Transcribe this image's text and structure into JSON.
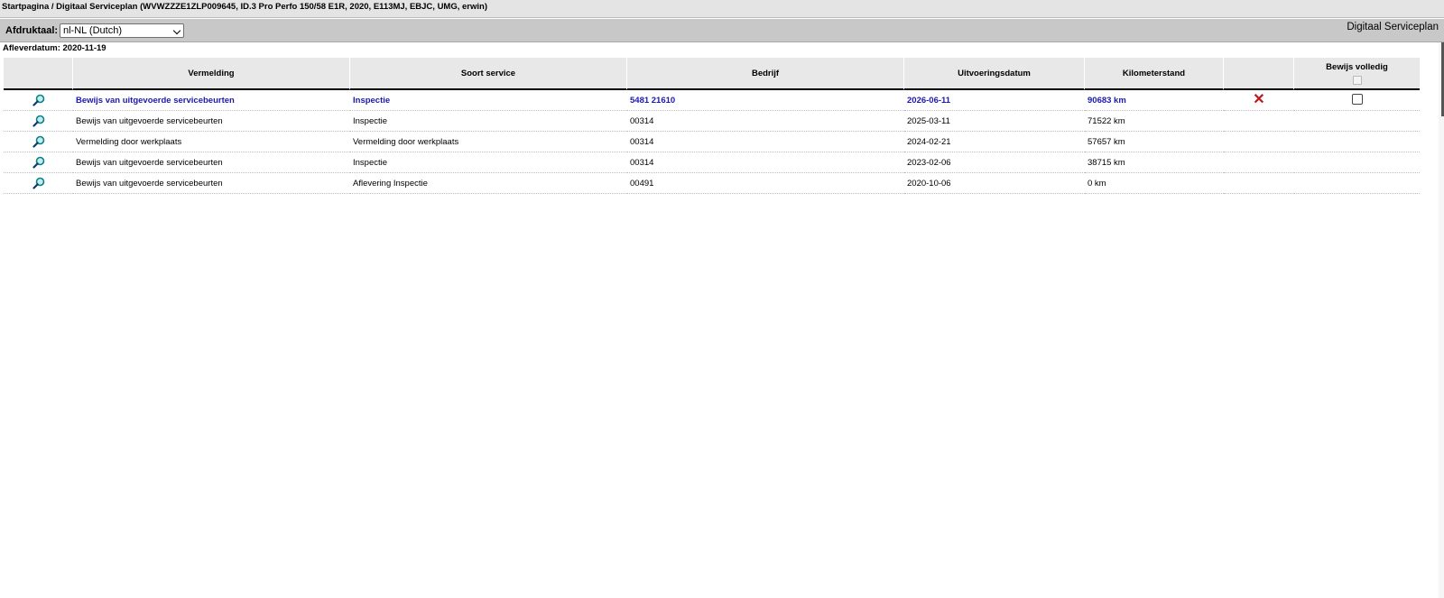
{
  "breadcrumb": "Startpagina / Digitaal Serviceplan (WVWZZZE1ZLP009645, ID.3 Pro Perfo 150/58 E1R, 2020, E113MJ, EBJC, UMG, erwin)",
  "toolbar": {
    "print_language_label": "Afdruktaal:",
    "print_language_value": "nl-NL (Dutch)",
    "module_title": "Digitaal Serviceplan"
  },
  "delivery_date": "Afleverdatum: 2020-11-19",
  "table": {
    "headers": {
      "vermelding": "Vermelding",
      "soort_service": "Soort service",
      "bedrijf": "Bedrijf",
      "uitvoeringsdatum": "Uitvoeringsdatum",
      "kilometerstand": "Kilometerstand",
      "bewijs_volledig": "Bewijs volledig"
    },
    "rows": [
      {
        "vermelding": "Bewijs van uitgevoerde servicebeurten",
        "soort": "Inspectie",
        "bedrijf": "5481 21610",
        "datum": "2026-06-11",
        "km": "90683 km"
      },
      {
        "vermelding": "Bewijs van uitgevoerde servicebeurten",
        "soort": "Inspectie",
        "bedrijf": "00314",
        "datum": "2025-03-11",
        "km": "71522 km"
      },
      {
        "vermelding": "Vermelding door werkplaats",
        "soort": "Vermelding door werkplaats",
        "bedrijf": "00314",
        "datum": "2024-02-21",
        "km": "57657 km"
      },
      {
        "vermelding": "Bewijs van uitgevoerde servicebeurten",
        "soort": "Inspectie",
        "bedrijf": "00314",
        "datum": "2023-02-06",
        "km": "38715 km"
      },
      {
        "vermelding": "Bewijs van uitgevoerde servicebeurten",
        "soort": "Aflevering Inspectie",
        "bedrijf": "00491",
        "datum": "2020-10-06",
        "km": "0 km"
      }
    ]
  },
  "icons": {
    "view": "magnifier-icon",
    "delete": "delete-x-icon"
  },
  "colors": {
    "active_row": "#1a1ab0",
    "delete": "#c0141b",
    "header_bg": "#e8e8e8",
    "toolbar_bg": "#c8c8c8"
  }
}
